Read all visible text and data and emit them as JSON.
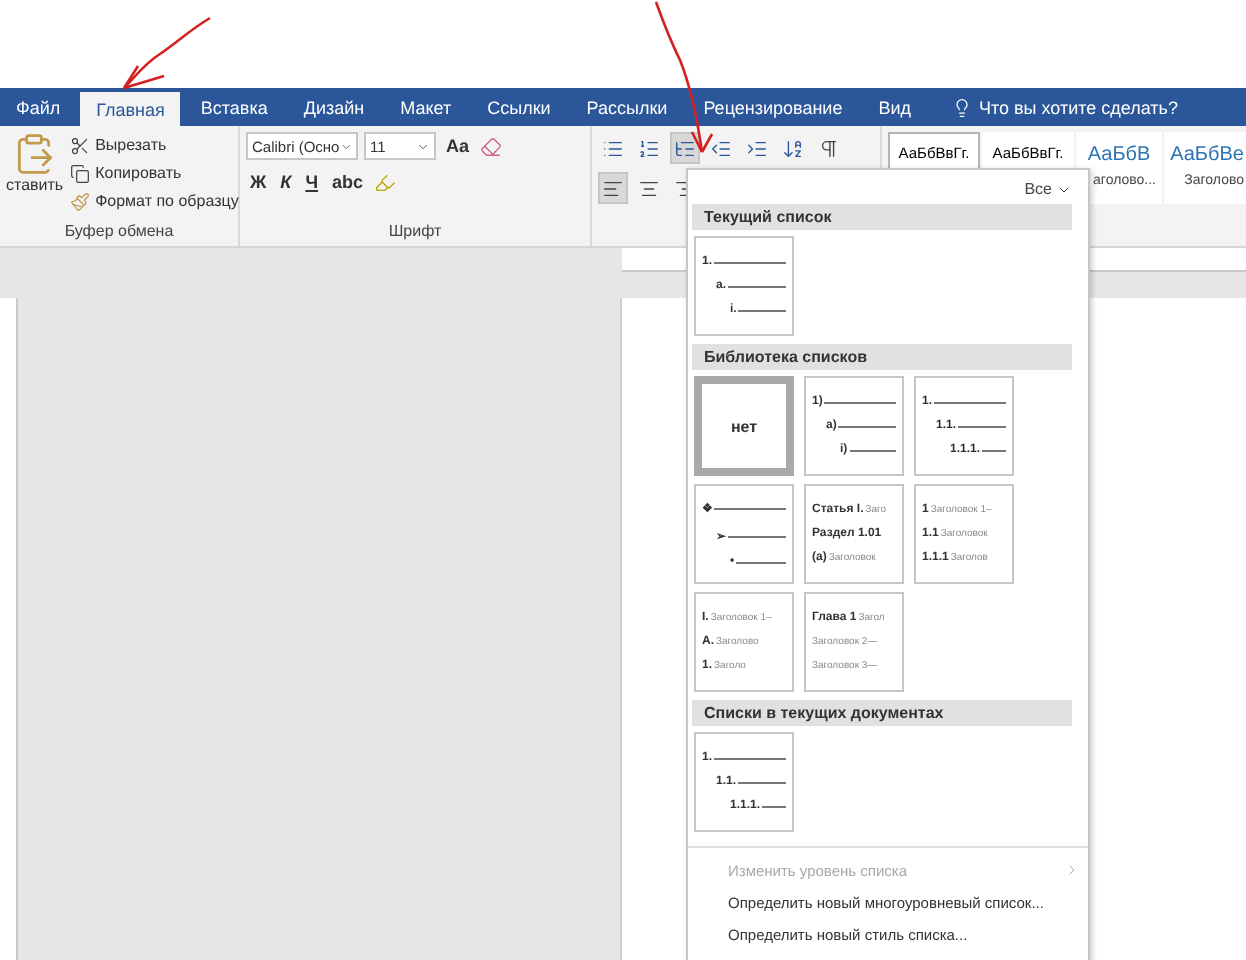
{
  "tabs": [
    {
      "label": "Файл",
      "selected": false
    },
    {
      "label": "Главная",
      "selected": true
    },
    {
      "label": "Вставка",
      "selected": false
    },
    {
      "label": "Дизайн",
      "selected": false
    },
    {
      "label": "Макет",
      "selected": false
    },
    {
      "label": "Ссылки",
      "selected": false
    },
    {
      "label": "Рассылки",
      "selected": false
    },
    {
      "label": "Рецензирование",
      "selected": false
    },
    {
      "label": "Вид",
      "selected": false
    }
  ],
  "tell_me": "Что вы хотите сделать?",
  "clipboard": {
    "paste_label": "ставить",
    "items": [
      "Вырезать",
      "Копировать",
      "Формат по образцу"
    ],
    "group_label": "Буфер обмена"
  },
  "font": {
    "name": "Calibri (Осно",
    "size": "11",
    "case_button": "Aa",
    "format_buttons": [
      "Ж",
      "К",
      "Ч",
      "abc"
    ],
    "group_label": "Шрифт"
  },
  "paragraph": {
    "multilevel_pressed": true,
    "alignments": [
      {
        "selected": true
      },
      {
        "selected": false
      },
      {
        "selected": false
      }
    ]
  },
  "styles": [
    {
      "sample": "АаБбВвГг.",
      "selected": true,
      "kind": "normal"
    },
    {
      "sample": "АаБбВвГг.",
      "selected": false,
      "kind": "normal"
    },
    {
      "sample": "АаБбВ",
      "name": "аголово...",
      "selected": false,
      "kind": "heading"
    },
    {
      "sample": "АаБбВе",
      "name": "Заголово",
      "selected": false,
      "kind": "heading"
    }
  ],
  "multilevel_menu": {
    "filter": "Все",
    "sections": [
      {
        "title": "Текущий список",
        "tiles": [
          {
            "kind": "outline",
            "selected": false,
            "lines": [
              {
                "num": "1."
              },
              {
                "num": "a."
              },
              {
                "num": "i."
              }
            ]
          }
        ]
      },
      {
        "title": "Библиотека списков",
        "tiles": [
          {
            "kind": "none",
            "selected": true,
            "label": "нет"
          },
          {
            "kind": "outline",
            "selected": false,
            "lines": [
              {
                "num": "1)"
              },
              {
                "num": "a)"
              },
              {
                "num": "i)"
              }
            ]
          },
          {
            "kind": "outline",
            "selected": false,
            "lines": [
              {
                "num": "1."
              },
              {
                "num": "1.1."
              },
              {
                "num": "1.1.1."
              }
            ]
          },
          {
            "kind": "outline",
            "selected": false,
            "lines": [
              {
                "num": "❖"
              },
              {
                "num": "➢"
              },
              {
                "num": "•"
              }
            ]
          },
          {
            "kind": "heading",
            "selected": false,
            "lines": [
              {
                "num": "Статья I.",
                "text": "Заго"
              },
              {
                "num": "Раздел 1.01"
              },
              {
                "num": "(a)",
                "text": "Заголовок"
              }
            ]
          },
          {
            "kind": "heading",
            "selected": false,
            "lines": [
              {
                "num": "1",
                "text": "Заголовок 1–"
              },
              {
                "num": "1.1",
                "text": "Заголовок"
              },
              {
                "num": "1.1.1",
                "text": "Заголов"
              }
            ]
          },
          {
            "kind": "heading",
            "selected": false,
            "lines": [
              {
                "num": "I.",
                "text": "Заголовок 1–"
              },
              {
                "num": "A.",
                "text": "Заголово"
              },
              {
                "num": "1.",
                "text": "Заголо"
              }
            ]
          },
          {
            "kind": "heading",
            "selected": false,
            "lines": [
              {
                "num": "Глава 1",
                "text": "Загол"
              },
              {
                "text": "Заголовок 2—"
              },
              {
                "text": "Заголовок 3—"
              }
            ]
          }
        ]
      },
      {
        "title": "Списки в текущих документах",
        "tiles": [
          {
            "kind": "outline",
            "selected": false,
            "lines": [
              {
                "num": "1."
              },
              {
                "num": "1.1."
              },
              {
                "num": "1.1.1."
              }
            ]
          }
        ]
      }
    ],
    "commands": [
      {
        "label": "Изменить уровень списка",
        "disabled": true,
        "submenu": true
      },
      {
        "label": "Определить новый многоуровневый список...",
        "disabled": false,
        "submenu": false
      },
      {
        "label": "Определить новый стиль списка...",
        "disabled": false,
        "submenu": false
      }
    ]
  }
}
